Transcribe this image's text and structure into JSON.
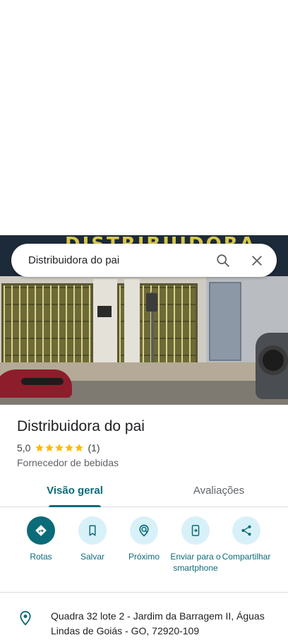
{
  "search": {
    "query": "Distribuidora do pai",
    "search_icon": "search-icon",
    "close_icon": "close-icon"
  },
  "hero": {
    "sign_text": "DISTRIBUIDORA"
  },
  "place": {
    "title": "Distribuidora do pai",
    "rating": "5,0",
    "stars": 5,
    "review_count": "(1)",
    "category": "Fornecedor de bebidas"
  },
  "tabs": [
    {
      "label": "Visão geral",
      "active": true
    },
    {
      "label": "Avaliações",
      "active": false
    }
  ],
  "actions": [
    {
      "label": "Rotas",
      "icon": "directions-icon"
    },
    {
      "label": "Salvar",
      "icon": "bookmark-icon"
    },
    {
      "label": "Próximo",
      "icon": "nearby-icon"
    },
    {
      "label": "Enviar para o smartphone",
      "icon": "send-to-phone-icon"
    },
    {
      "label": "Compartilhar",
      "icon": "share-icon"
    }
  ],
  "address": {
    "icon": "location-pin-icon",
    "text": "Quadra 32 lote 2 - Jardim da Barragem II, Águas Lindas de Goiás - GO, 72920-109"
  },
  "colors": {
    "accent": "#0b6b78",
    "action_bg": "#d8f1f9",
    "star": "#fbbc04"
  }
}
